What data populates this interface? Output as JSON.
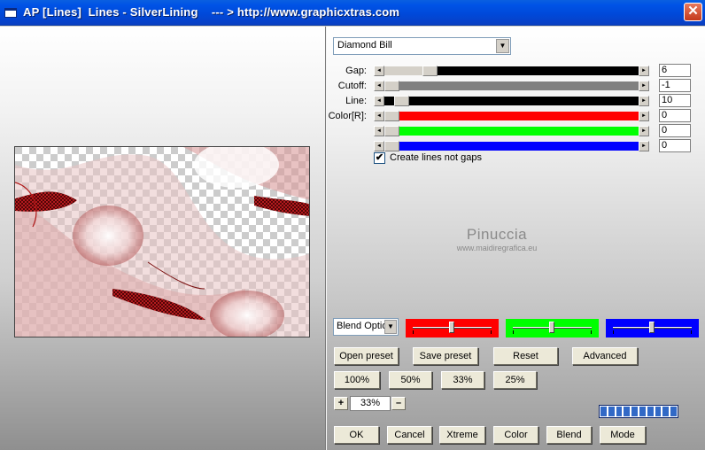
{
  "window": {
    "title": "AP [Lines]  Lines - SilverLining    --- > http://www.graphicxtras.com",
    "close_symbol": "✕"
  },
  "icons": {
    "app": "app-window-icon",
    "close": "close-icon",
    "scroll_left": "arrow-left-icon",
    "scroll_right": "arrow-right-icon",
    "dropdown": "chevron-down-icon",
    "check": "checkmark-icon"
  },
  "preset": {
    "selected": "Diamond Bill",
    "arrow": "▼"
  },
  "params": [
    {
      "label": "Gap:",
      "value": "6",
      "fill": "#000000",
      "level": 0.16
    },
    {
      "label": "Cutoff:",
      "value": "-1",
      "fill": "#808080",
      "level": 0.0
    },
    {
      "label": "Line:",
      "value": "10",
      "fill": "#000000",
      "level": 0.04
    },
    {
      "label": "Color[R]:",
      "value": "0",
      "fill": "#ff0000",
      "level": 0.0
    },
    {
      "label": "",
      "value": "0",
      "fill": "#00ff00",
      "level": 0.0
    },
    {
      "label": "",
      "value": "0",
      "fill": "#0000ff",
      "level": 0.0
    }
  ],
  "arrows": {
    "left": "◄",
    "right": "►"
  },
  "option": {
    "label": "Create lines not gaps",
    "checked": true,
    "check_symbol": "✔"
  },
  "watermark": {
    "name": "Pinuccia",
    "site": "www.maidiregrafica.eu"
  },
  "blend": {
    "selected": "Blend Optio",
    "arrow": "▼"
  },
  "mini_sliders": [
    {
      "color": "#ff0000",
      "level": 0.5
    },
    {
      "color": "#00ff00",
      "level": 0.5
    },
    {
      "color": "#0000ff",
      "level": 0.5
    }
  ],
  "buttons": {
    "open_preset": "Open preset",
    "save_preset": "Save preset",
    "reset": "Reset",
    "advanced": "Advanced",
    "zoom100": "100%",
    "zoom50": "50%",
    "zoom33": "33%",
    "zoom25": "25%",
    "ok": "OK",
    "cancel": "Cancel",
    "xtreme": "Xtreme",
    "color": "Color",
    "blend": "Blend",
    "mode": "Mode"
  },
  "zoom": {
    "plus": "+",
    "minus": "–",
    "value": "33%"
  },
  "progress": {
    "segments": 10,
    "filled": 10,
    "color": "#3169c6"
  }
}
